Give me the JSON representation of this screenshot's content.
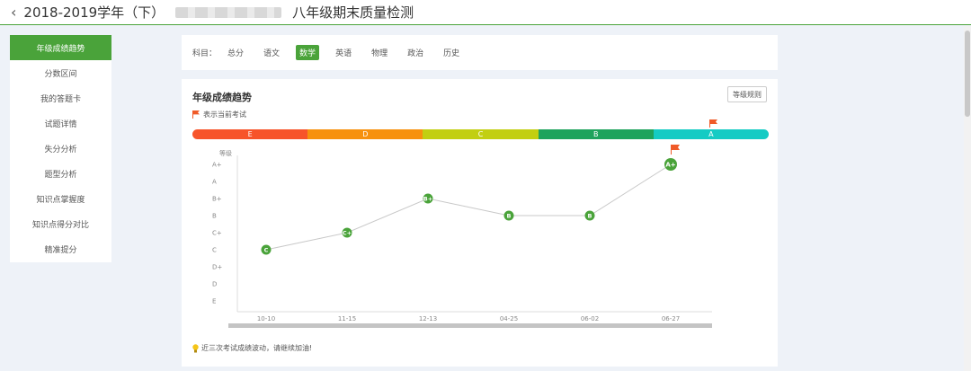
{
  "header": {
    "back_icon": "chevron-left-icon",
    "title_year": "2018-2019学年（下）",
    "title_exam": "八年级期末质量检测"
  },
  "sidebar": {
    "items": [
      {
        "label": "年级成绩趋势",
        "active": true
      },
      {
        "label": "分数区间",
        "active": false
      },
      {
        "label": "我的答题卡",
        "active": false
      },
      {
        "label": "试题详情",
        "active": false
      },
      {
        "label": "失分分析",
        "active": false
      },
      {
        "label": "题型分析",
        "active": false
      },
      {
        "label": "知识点掌握度",
        "active": false
      },
      {
        "label": "知识点得分对比",
        "active": false
      },
      {
        "label": "精准提分",
        "active": false
      }
    ]
  },
  "subjects": {
    "label": "科目：",
    "items": [
      {
        "label": "总分",
        "active": false
      },
      {
        "label": "语文",
        "active": false
      },
      {
        "label": "数学",
        "active": true
      },
      {
        "label": "英语",
        "active": false
      },
      {
        "label": "物理",
        "active": false
      },
      {
        "label": "政治",
        "active": false
      },
      {
        "label": "历史",
        "active": false
      }
    ]
  },
  "trend": {
    "title": "年级成绩趋势",
    "rule_button": "等级规则",
    "legend_text": "表示当前考试",
    "tip": "近三次考试成绩波动，请继续加油!",
    "colors": {
      "accent": "#4aa33a",
      "flag": "#f05a28",
      "line": "#c8c8c8",
      "point": "#4aa33a"
    },
    "grade_bar": [
      {
        "label": "E",
        "color": "#f7542a"
      },
      {
        "label": "D",
        "color": "#f7910d"
      },
      {
        "label": "C",
        "color": "#c2cf11"
      },
      {
        "label": "B",
        "color": "#1ea35c"
      },
      {
        "label": "A",
        "color": "#14cbc4",
        "current": true
      }
    ]
  },
  "chart_data": {
    "type": "line",
    "title": "",
    "ylabel": "等级",
    "xlabel": "",
    "y_levels": [
      "A+",
      "A",
      "B+",
      "B",
      "C+",
      "C",
      "D+",
      "D",
      "E"
    ],
    "categories": [
      "10-10",
      "11-15",
      "12-13",
      "04-25",
      "06-02",
      "06-27"
    ],
    "values": [
      "C",
      "C+",
      "B+",
      "B",
      "B",
      "A+"
    ],
    "current_index": 5,
    "grid": false
  }
}
